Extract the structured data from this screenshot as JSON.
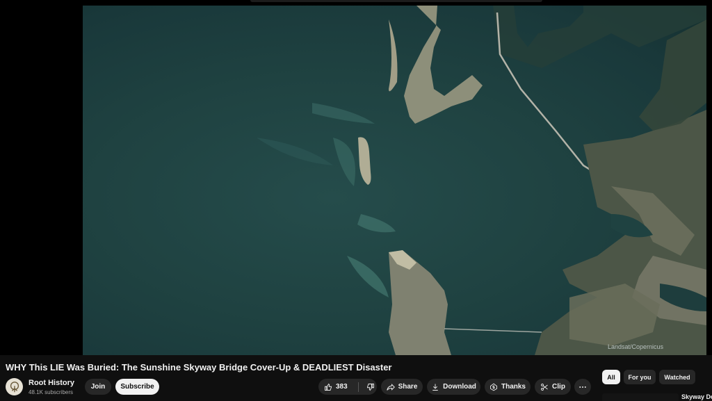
{
  "video": {
    "title": "WHY This LIE Was Buried: The Sunshine Skyway Bridge Cover-Up & DEADLIEST Disaster",
    "watermark": "Landsat/Copernicus"
  },
  "channel": {
    "name": "Root History",
    "subscribers": "48.1K subscribers",
    "avatar_icon": "tree-logo-icon"
  },
  "actions": {
    "join_label": "Join",
    "subscribe_label": "Subscribe",
    "like_count": "383",
    "share_label": "Share",
    "download_label": "Download",
    "thanks_label": "Thanks",
    "clip_label": "Clip"
  },
  "chips": {
    "all": "All",
    "for_you": "For you",
    "watched": "Watched"
  },
  "next_video": {
    "title": "Skyway Do"
  },
  "colors": {
    "background": "#0f0f0f",
    "button": "#272727",
    "button_active": "#f1f1f1",
    "water": "#1f4241",
    "land": "#7a7d68"
  }
}
